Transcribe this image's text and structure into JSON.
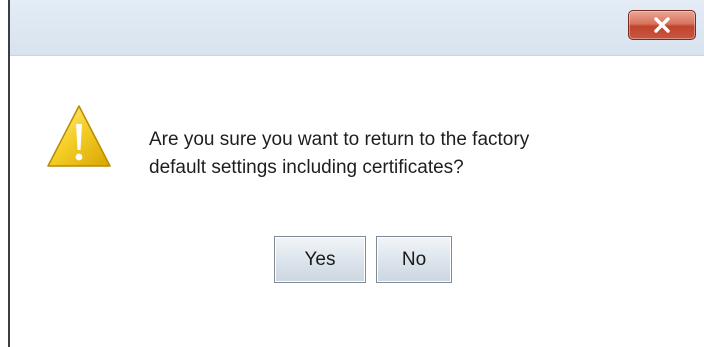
{
  "window": {
    "close_icon": "close-icon",
    "close_color": "#c9563f",
    "title_bar_color": "#dce6f1"
  },
  "dialog": {
    "icon": "warning-icon",
    "icon_color": "#f2c200",
    "message_line1": "Are you sure you want to return to the factory",
    "message_line2": "default settings including certificates?"
  },
  "buttons": {
    "yes_label": "Yes",
    "no_label": "No"
  }
}
